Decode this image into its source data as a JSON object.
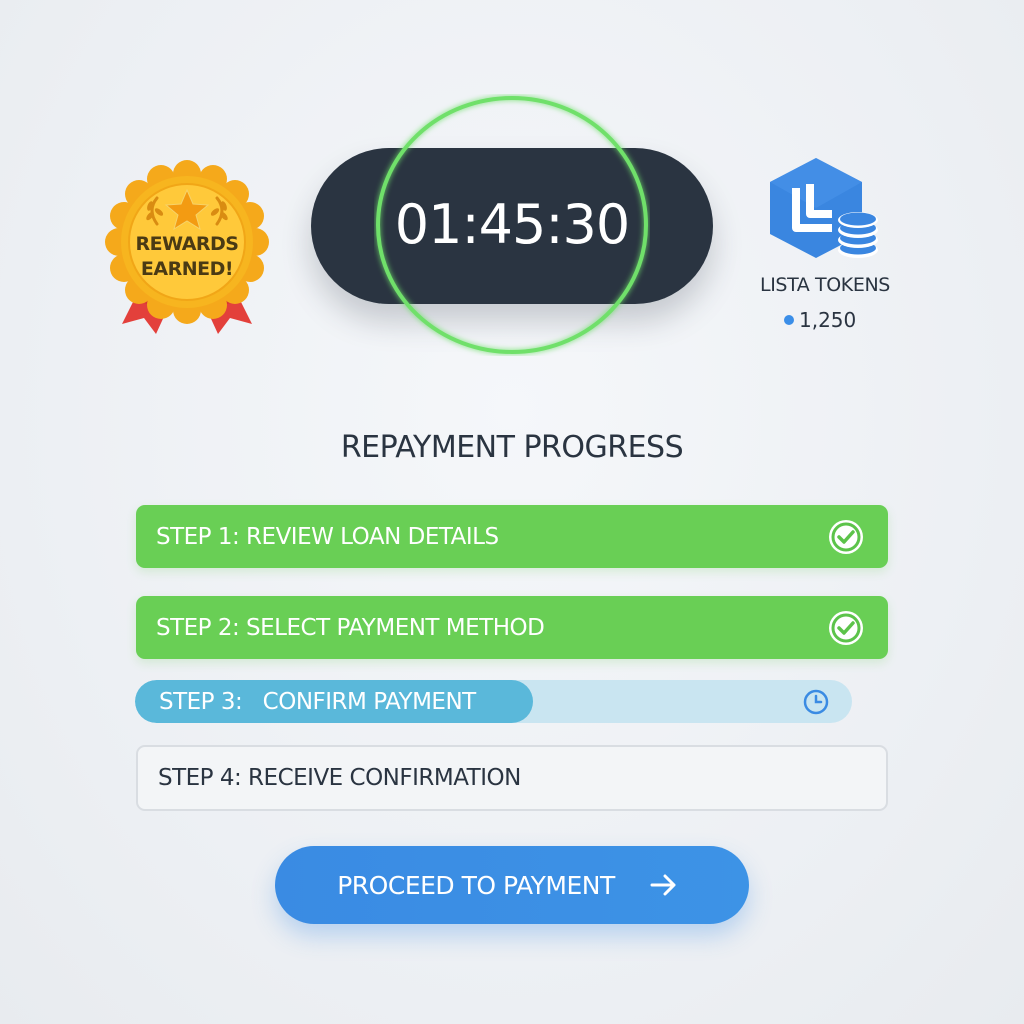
{
  "rewards_badge": {
    "line1": "REWARDS",
    "line2": "EARNED!",
    "icon": "ribbon-badge-icon",
    "colors": {
      "gold": "#f6b81f",
      "ribbon": "#e3403b"
    }
  },
  "timer": {
    "value": "01:45:30",
    "ring_color": "#6fe06a"
  },
  "tokens": {
    "label": "LISTA TOKENS",
    "amount": "1,250",
    "icon": "lista-token-icon",
    "accent": "#3b8ee8"
  },
  "progress": {
    "title": "REPAYMENT PROGRESS",
    "steps": [
      {
        "label": "STEP 1: REVIEW LOAN DETAILS",
        "status": "complete",
        "icon": "check-circle-icon"
      },
      {
        "label": "STEP 2: SELECT PAYMENT METHOD",
        "status": "complete",
        "icon": "check-circle-icon"
      },
      {
        "label": "STEP 3:   CONFIRM PAYMENT",
        "status": "in-progress",
        "icon": "clock-icon",
        "progress_fraction": 0.555
      },
      {
        "label": "STEP 4: RECEIVE CONFIRMATION",
        "status": "pending"
      }
    ],
    "colors": {
      "complete": "#69cf55",
      "active": "#5ab8da",
      "active_track": "#c9e5f1"
    }
  },
  "cta": {
    "label": "PROCEED TO PAYMENT",
    "icon": "arrow-right-icon",
    "color": "#3a8be3"
  }
}
